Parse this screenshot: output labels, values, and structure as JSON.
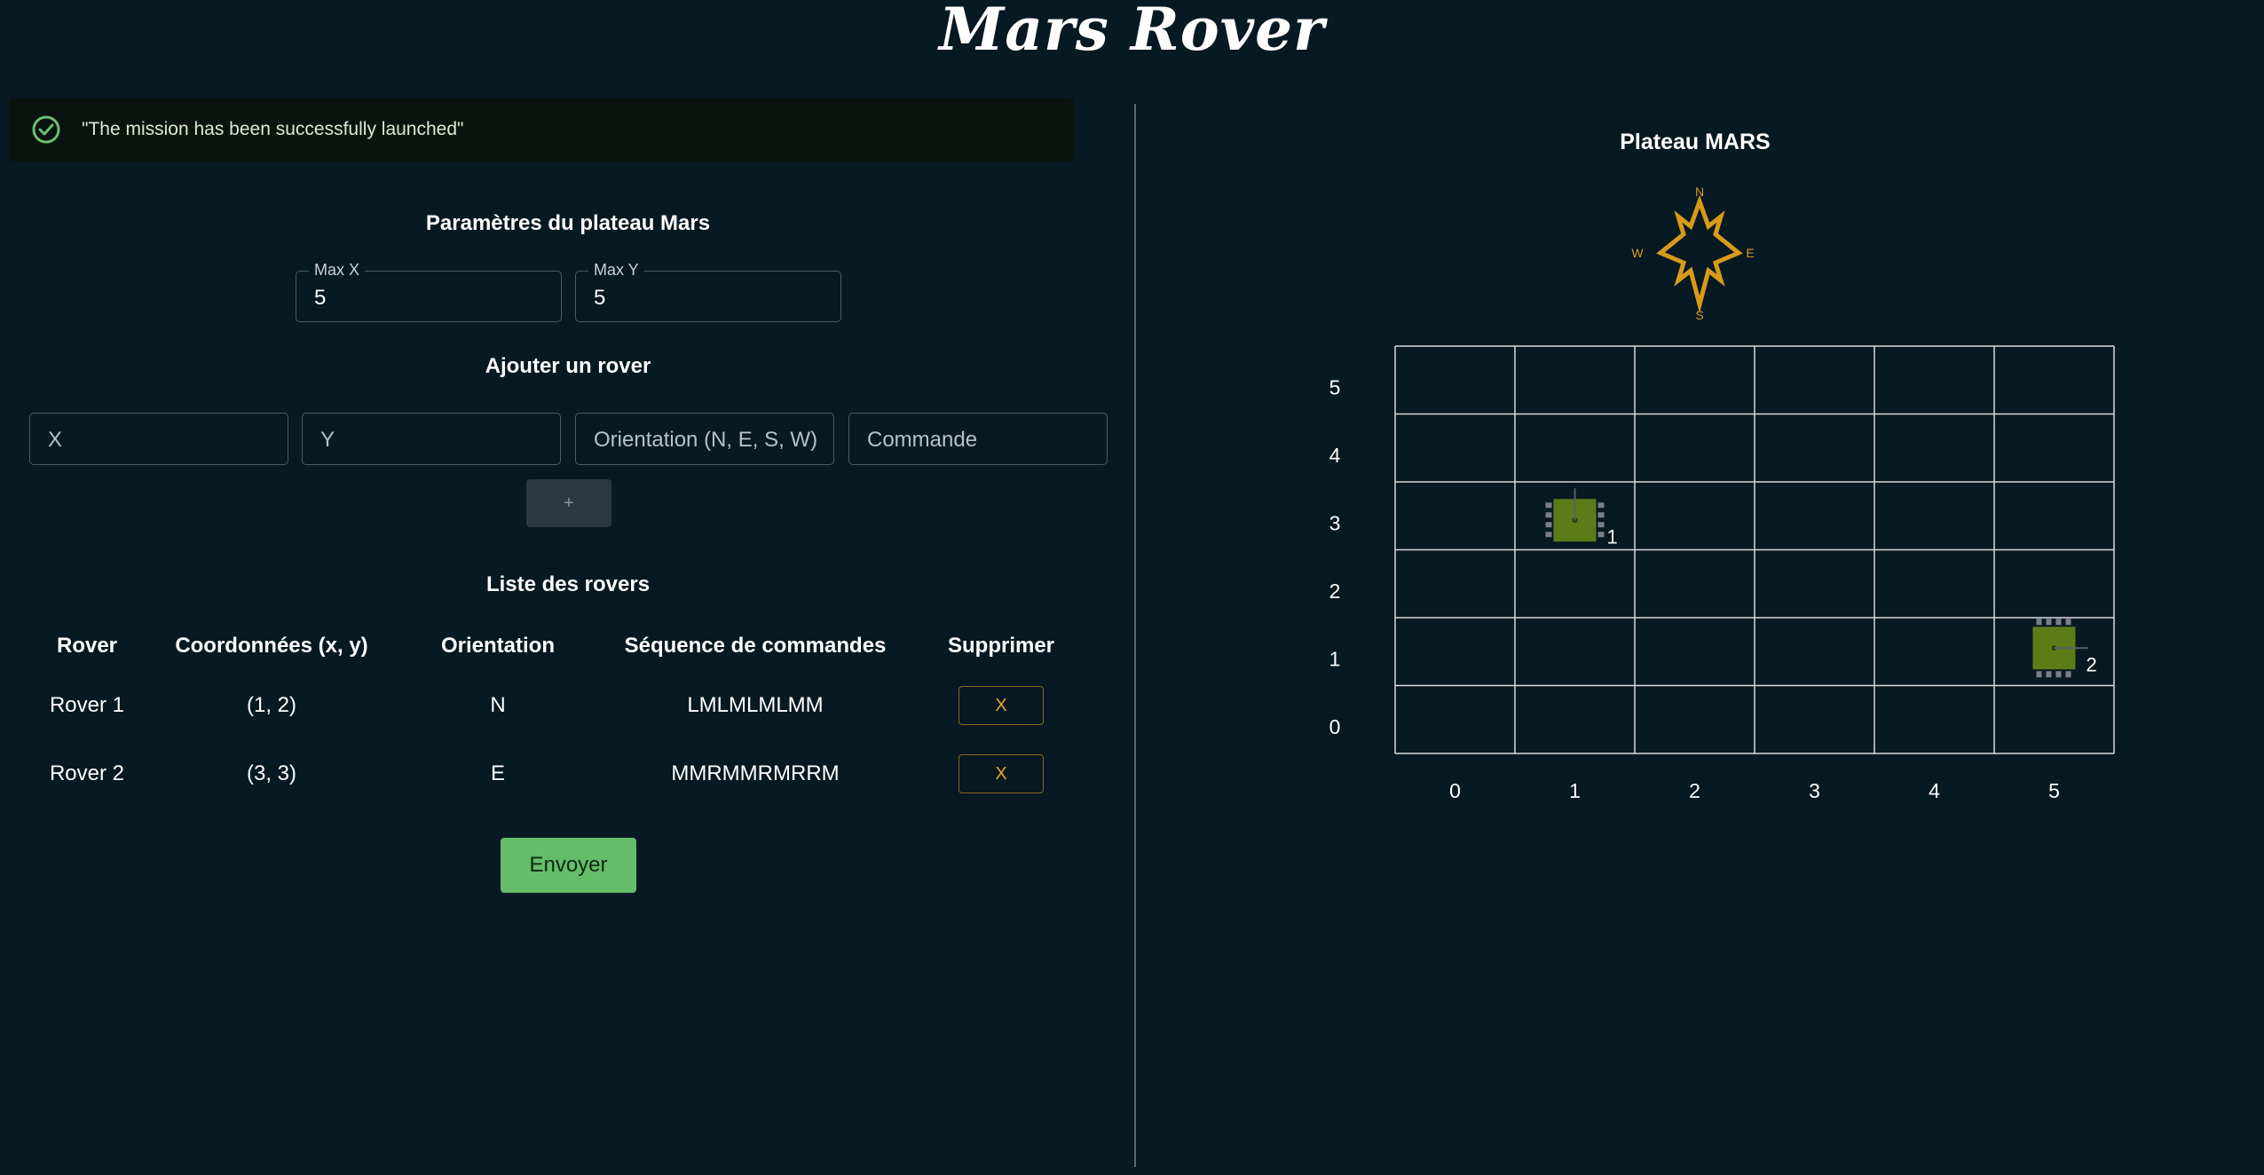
{
  "app": {
    "title": "Mars Rover"
  },
  "alert": {
    "message": "\"The mission has been successfully launched\""
  },
  "plateau_params": {
    "title": "Paramètres du plateau Mars",
    "max_x": {
      "label": "Max X",
      "value": "5"
    },
    "max_y": {
      "label": "Max Y",
      "value": "5"
    }
  },
  "add_rover": {
    "title": "Ajouter un rover",
    "x_placeholder": "X",
    "y_placeholder": "Y",
    "orientation_placeholder": "Orientation (N, E, S, W)",
    "command_placeholder": "Commande",
    "add_label": "+"
  },
  "rover_list": {
    "title": "Liste des rovers",
    "headers": [
      "Rover",
      "Coordonnées (x, y)",
      "Orientation",
      "Séquence de commandes",
      "Supprimer"
    ],
    "rows": [
      {
        "rover": "Rover 1",
        "coords": "(1, 2)",
        "orientation": "N",
        "commands": "LMLMLMLMM",
        "delete_label": "X"
      },
      {
        "rover": "Rover 2",
        "coords": "(3, 3)",
        "orientation": "E",
        "commands": "MMRMMRMRRM",
        "delete_label": "X"
      }
    ]
  },
  "send": {
    "label": "Envoyer"
  },
  "board": {
    "title": "Plateau MARS",
    "compass": {
      "n": "N",
      "e": "E",
      "s": "S",
      "w": "W"
    },
    "x_labels": [
      "0",
      "1",
      "2",
      "3",
      "4",
      "5"
    ],
    "y_labels": [
      "5",
      "4",
      "3",
      "2",
      "1",
      "0"
    ],
    "rovers": [
      {
        "label": "1",
        "x": 1,
        "y": 3,
        "heading": "N"
      },
      {
        "label": "2",
        "x": 5,
        "y": 1,
        "heading": "E"
      }
    ]
  },
  "colors": {
    "background": "#071923",
    "accent_orange": "#d99a1a",
    "send_green": "#63bd69",
    "rover_green": "#5c7c18",
    "grid": "#d9d9d9"
  }
}
